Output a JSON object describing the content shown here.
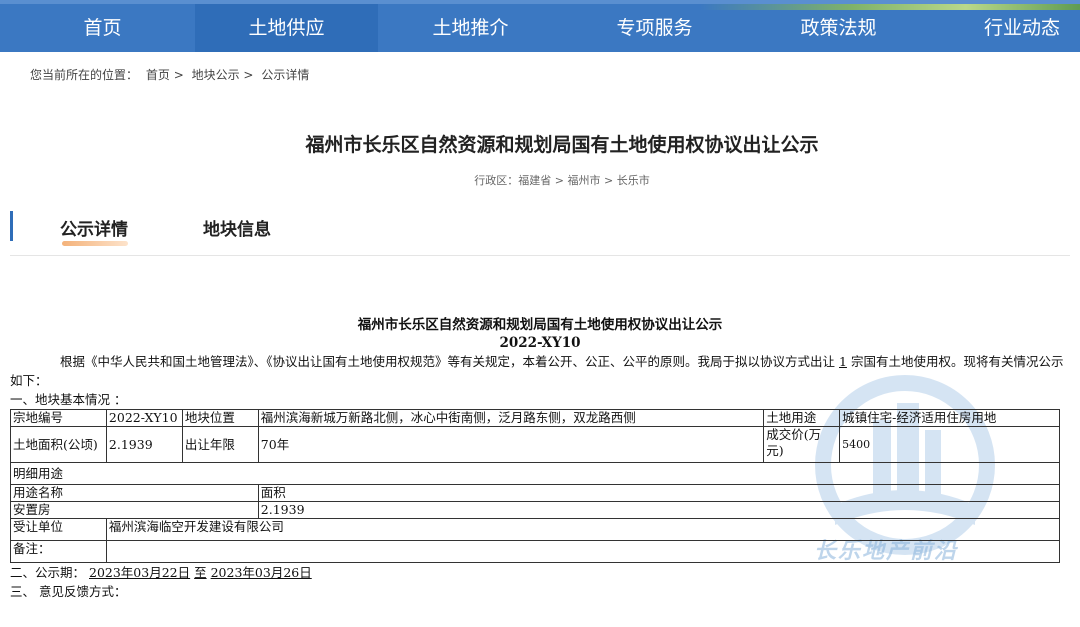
{
  "nav": {
    "items": [
      "首页",
      "土地供应",
      "土地推介",
      "专项服务",
      "政策法规",
      "行业动态"
    ],
    "active_index": 1
  },
  "breadcrumb": {
    "prefix": "您当前所在的位置：",
    "items": [
      "首页",
      "地块公示",
      "公示详情"
    ],
    "separator": ">"
  },
  "page": {
    "title": "福州市长乐区自然资源和规划局国有土地使用权协议出让公示",
    "region": "行政区：福建省 > 福州市 > 长乐市"
  },
  "tabs": [
    "公示详情",
    "地块信息"
  ],
  "doc": {
    "title": "福州市长乐区自然资源和规划局国有土地使用权协议出让公示",
    "code": "2022-XY10",
    "intro_a": "根据《中华人民共和国土地管理法》、《协议出让国有土地使用权规范》等有关规定，本着公开、公正、公平的原则。我局于拟以协议方式出让",
    "intro_count": "1",
    "intro_b": "宗国有土地使用权。现将有关情况公示如下：",
    "section1": "一、地块基本情况 ：",
    "table": {
      "r1": [
        "宗地编号",
        "2022-XY10",
        "地块位置",
        "福州滨海新城万新路北侧，冰心中街南侧，泛月路东侧，双龙路西侧",
        "土地用途",
        "城镇住宅-经济适用住房用地"
      ],
      "r2": [
        "土地面积(公顷)",
        "2.1939",
        "出让年限",
        "70年",
        "成交价(万元)",
        "5400"
      ],
      "detail_label": "明细用途",
      "r3": [
        "用途名称",
        "面积"
      ],
      "r4": [
        "安置房",
        "2.1939"
      ],
      "r5": [
        "受让单位",
        "福州滨海临空开发建设有限公司"
      ],
      "r6": [
        "备注：",
        ""
      ]
    },
    "section2_label": "二、公示期：",
    "period_start": "2023年03月22日",
    "period_to": "至",
    "period_end": "2023年03月26日",
    "section3": "三、 意见反馈方式："
  },
  "watermark": {
    "text": "长乐地产前沿"
  },
  "colors": {
    "nav_bg": "#3b78c2",
    "nav_active": "#2f6db8",
    "tab_underline": "#f4b27a"
  }
}
